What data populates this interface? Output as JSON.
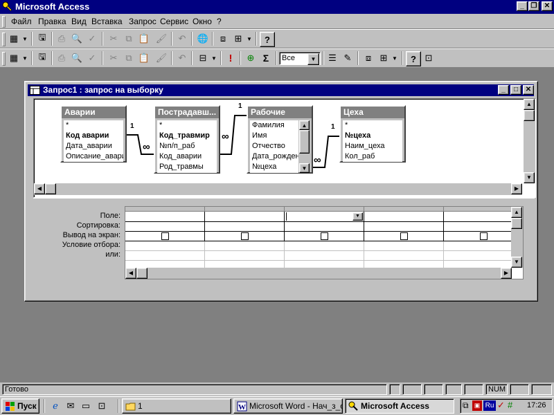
{
  "app": {
    "title": "Microsoft Access"
  },
  "menu": [
    "Файл",
    "Правка",
    "Вид",
    "Вставка",
    "Запрос",
    "Сервис",
    "Окно",
    "?"
  ],
  "toolbar": {
    "top_values_combo": "Все",
    "totals_symbol": "Σ",
    "run_symbol": "!"
  },
  "query_window": {
    "title": "Запрос1 : запрос на выборку",
    "tables": [
      {
        "name": "Аварии",
        "fields": [
          "*",
          "Код аварии",
          "Дата_аварии",
          "Описание_аварии"
        ],
        "key_fields": [
          "Код аварии"
        ]
      },
      {
        "name": "Пострадавшие",
        "header_text": "Пострадавш...",
        "fields": [
          "*",
          "Код_травмир",
          "№п/п_раб",
          "Код_аварии",
          "Род_травмы"
        ],
        "key_fields": [
          "Код_травмир"
        ]
      },
      {
        "name": "Рабочие",
        "fields": [
          "Фамилия",
          "Имя",
          "Отчество",
          "Дата_рождения",
          "№цеха"
        ],
        "key_fields": []
      },
      {
        "name": "Цеха",
        "fields": [
          "*",
          "№цеха",
          "Наим_цеха",
          "Кол_раб"
        ],
        "key_fields": [
          "№цеха"
        ]
      }
    ],
    "relation_labels": {
      "one": "1",
      "many": "∞"
    },
    "grid_rows": [
      "Поле:",
      "Сортировка:",
      "Вывод на экран:",
      "Условие отбора:",
      "или:"
    ],
    "grid_columns": 5
  },
  "status": {
    "text": "Готово",
    "num": "NUM"
  },
  "taskbar": {
    "start": "Пуск",
    "buttons": [
      "1",
      "Microsoft Word - Нач_з_о...",
      "Microsoft Access"
    ],
    "clock": "17:26",
    "lang": "Ru"
  },
  "colors": {
    "titlebar": "#000080",
    "face": "#c0c0c0",
    "desktop": "#808080"
  }
}
